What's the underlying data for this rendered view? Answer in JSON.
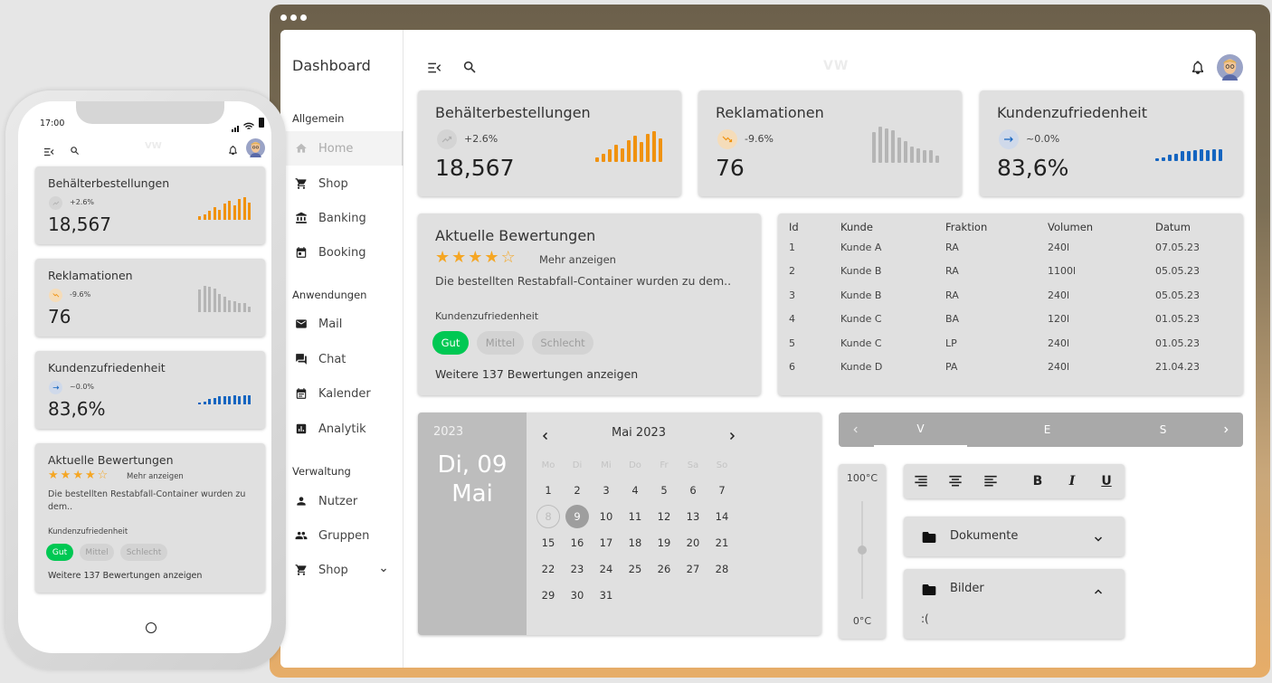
{
  "sidebar": {
    "title": "Dashboard",
    "sections": [
      {
        "label": "Allgemein",
        "items": [
          {
            "label": "Home",
            "icon": "home-icon"
          },
          {
            "label": "Shop",
            "icon": "cart-icon"
          },
          {
            "label": "Banking",
            "icon": "bank-icon"
          },
          {
            "label": "Booking",
            "icon": "calendar-icon"
          }
        ]
      },
      {
        "label": "Anwendungen",
        "items": [
          {
            "label": "Mail",
            "icon": "mail-icon"
          },
          {
            "label": "Chat",
            "icon": "chat-icon"
          },
          {
            "label": "Kalender",
            "icon": "calendar-icon"
          },
          {
            "label": "Analytik",
            "icon": "analytics-icon"
          }
        ]
      },
      {
        "label": "Verwaltung",
        "items": [
          {
            "label": "Nutzer",
            "icon": "user-icon"
          },
          {
            "label": "Gruppen",
            "icon": "group-icon"
          },
          {
            "label": "Shop",
            "icon": "cart-icon"
          }
        ]
      }
    ]
  },
  "topbar": {
    "logo": "VW"
  },
  "kpis": [
    {
      "title": "Behälterbestellungen",
      "trend": "+2.6%",
      "value": "18,567",
      "trend_icon": "trend-up-icon",
      "color": "#f0920f",
      "bars": [
        0.15,
        0.25,
        0.4,
        0.55,
        0.45,
        0.7,
        0.85,
        0.65,
        0.9,
        1.0,
        0.75
      ]
    },
    {
      "title": "Reklamationen",
      "trend": "-9.6%",
      "value": "76",
      "trend_icon": "trend-down-icon",
      "color": "#b5b5b5",
      "bars": [
        0.85,
        1.0,
        0.95,
        0.9,
        0.7,
        0.6,
        0.45,
        0.4,
        0.35,
        0.35,
        0.2
      ]
    },
    {
      "title": "Kundenzufriedenheit",
      "trend": "~0.0%",
      "value": "83,6%",
      "trend_icon": "trend-flat-icon",
      "color": "#1565c0",
      "bars": [
        0.2,
        0.3,
        0.5,
        0.6,
        0.8,
        0.8,
        0.85,
        0.9,
        0.85,
        0.9,
        0.9
      ]
    }
  ],
  "review": {
    "title": "Aktuelle Bewertungen",
    "rating": 4,
    "more": "Mehr anzeigen",
    "text": "Die bestellten Restabfall-Container wurden zu dem..",
    "label": "Kundenzufriedenheit",
    "chips": [
      "Gut",
      "Mittel",
      "Schlecht"
    ],
    "footer": "Weitere 137 Bewertungen anzeigen"
  },
  "phone": {
    "time": "17:00",
    "review_text": "Die bestellten Restabfall-Container wurden zu dem.."
  },
  "table": {
    "headers": [
      "Id",
      "Kunde",
      "Fraktion",
      "Volumen",
      "Datum"
    ],
    "rows": [
      [
        "1",
        "Kunde A",
        "RA",
        "240l",
        "07.05.23"
      ],
      [
        "2",
        "Kunde B",
        "RA",
        "1100l",
        "05.05.23"
      ],
      [
        "3",
        "Kunde B",
        "RA",
        "240l",
        "05.05.23"
      ],
      [
        "4",
        "Kunde C",
        "BA",
        "120l",
        "01.05.23"
      ],
      [
        "5",
        "Kunde C",
        "LP",
        "240l",
        "01.05.23"
      ],
      [
        "6",
        "Kunde D",
        "PA",
        "240l",
        "21.04.23"
      ]
    ]
  },
  "calendar": {
    "year": "2023",
    "date_line1": "Di, 09",
    "date_line2": "Mai",
    "month": "Mai 2023",
    "weekdays": [
      "Mo",
      "Di",
      "Mi",
      "Do",
      "Fr",
      "Sa",
      "So"
    ],
    "days": [
      "1",
      "2",
      "3",
      "4",
      "5",
      "6",
      "7",
      "8",
      "9",
      "10",
      "11",
      "12",
      "13",
      "14",
      "15",
      "16",
      "17",
      "18",
      "19",
      "20",
      "21",
      "22",
      "23",
      "24",
      "25",
      "26",
      "27",
      "28",
      "29",
      "30",
      "31"
    ],
    "today": "8",
    "selected": "9"
  },
  "tabs": {
    "items": [
      "V",
      "E",
      "S"
    ],
    "active": "V"
  },
  "slider": {
    "max": "100°C",
    "min": "0°C",
    "value": 0.5
  },
  "accordion": [
    {
      "label": "Dokumente",
      "open": false
    },
    {
      "label": "Bilder",
      "open": true,
      "content": ":("
    }
  ]
}
